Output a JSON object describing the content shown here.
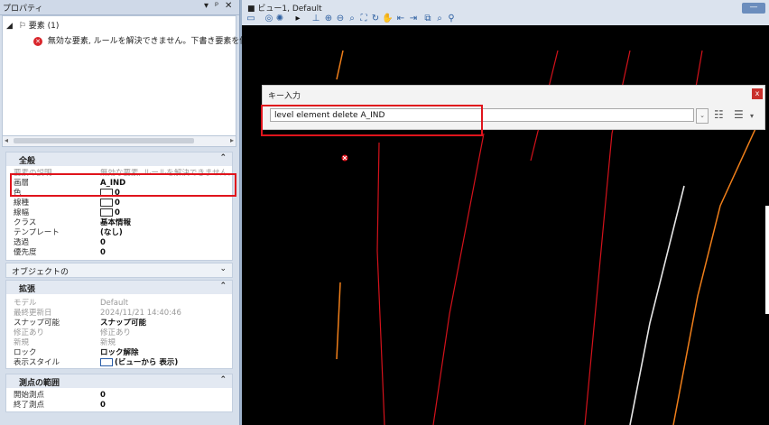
{
  "properties": {
    "title": "プロパティ",
    "controls": {
      "pin": "▾",
      "dock": "ᵖ",
      "close": "✕"
    },
    "tree": {
      "root": "要素 (1)",
      "error": "無効な要素, ルールを解決できません。下書き要素を修正"
    },
    "general": {
      "header": "全般",
      "rows": [
        {
          "key": "要素の説明",
          "value": "無効な要素, ルールを解決できません。"
        },
        {
          "key": "画層",
          "value": "A_IND"
        },
        {
          "key": "色",
          "value": "0"
        },
        {
          "key": "線種",
          "value": "0"
        },
        {
          "key": "線幅",
          "value": "0"
        },
        {
          "key": "クラス",
          "value": "基本情報"
        },
        {
          "key": "テンプレート",
          "value": "(なし)"
        },
        {
          "key": "透過",
          "value": "0"
        },
        {
          "key": "優先度",
          "value": "0"
        }
      ]
    },
    "object_header": "オブジェクトの",
    "extended": {
      "header": "拡張",
      "rows": [
        {
          "key": "モデル",
          "value": "Default"
        },
        {
          "key": "最終更新日",
          "value": "2024/11/21 14:40:46"
        },
        {
          "key": "スナップ可能",
          "value": "スナップ可能"
        },
        {
          "key": "修正あり",
          "value": "修正あり"
        },
        {
          "key": "新規",
          "value": "新規"
        },
        {
          "key": "ロック",
          "value": "ロック解除"
        },
        {
          "key": "表示スタイル",
          "value": "(ビューから 表示)"
        }
      ]
    },
    "range": {
      "header": "測点の範囲",
      "rows": [
        {
          "key": "開始測点",
          "value": "0"
        },
        {
          "key": "終了測点",
          "value": "0"
        }
      ]
    }
  },
  "view": {
    "title": "ビュー1, Default",
    "min_label": "—"
  },
  "keyin": {
    "title": "キー入力",
    "close": "x",
    "value": "level element delete A_IND"
  },
  "colors": {
    "accent_red": "#e0141c",
    "line_red": "#d4121b",
    "line_orange": "#f07f1a",
    "line_white": "#e6e6e6"
  }
}
